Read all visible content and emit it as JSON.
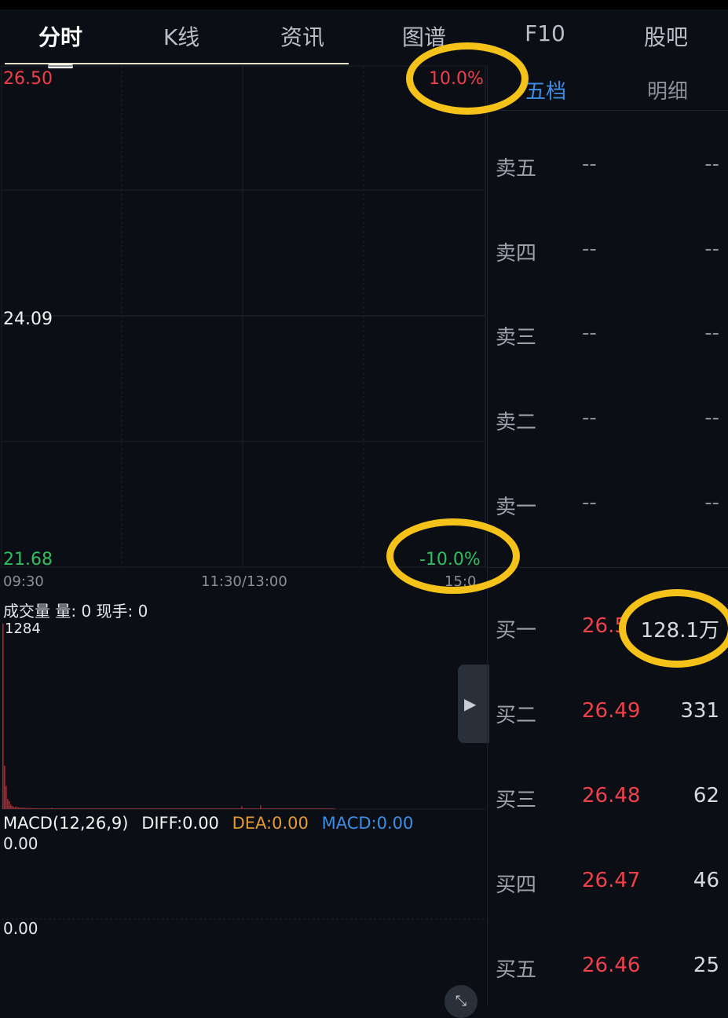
{
  "tabs": [
    {
      "label": "分时",
      "active": true
    },
    {
      "label": "K线"
    },
    {
      "label": "资讯"
    },
    {
      "label": "图谱"
    },
    {
      "label": "F10"
    },
    {
      "label": "股吧"
    }
  ],
  "chart": {
    "price_high": "26.50",
    "price_mid": "24.09",
    "price_low": "21.68",
    "pct_high": "10.0%",
    "pct_low": "-10.0%",
    "time_start": "09:30",
    "time_mid": "11:30/13:00",
    "time_end_partial": "15:0",
    "volume_title": "成交量  量: 0  现手: 0",
    "volume_max": "1284",
    "macd_label": "MACD(12,26,9)",
    "diff_label": "DIFF:0.00",
    "dea_label": "DEA:0.00",
    "macd_value_label": "MACD:0.00",
    "macd_top": "0.00",
    "macd_mid": "0.00",
    "volumes": [
      1284,
      300,
      160,
      70,
      55,
      30,
      22,
      14,
      14,
      14,
      10,
      10,
      10,
      9,
      9,
      8,
      8,
      7,
      7,
      7,
      6,
      6,
      6,
      6,
      6,
      5,
      5,
      5,
      5,
      5,
      5,
      10,
      5,
      5,
      5,
      5,
      5,
      5,
      5,
      5,
      5,
      5,
      5,
      5,
      5,
      5,
      5,
      5,
      5,
      5,
      5,
      5,
      5,
      5,
      5,
      5,
      5,
      5,
      5,
      5,
      5,
      5,
      5,
      5,
      5,
      5,
      5,
      5,
      5,
      5,
      5,
      5,
      5,
      5,
      5,
      5,
      5,
      5,
      5,
      5,
      5,
      5,
      5,
      5,
      5,
      5,
      5,
      5,
      5,
      5,
      5,
      5,
      5,
      5,
      5,
      5,
      5,
      5,
      5,
      5,
      5,
      5,
      5,
      5,
      5,
      5,
      5,
      5,
      5,
      5,
      5,
      5,
      5,
      5,
      5,
      5,
      5,
      5,
      5,
      5,
      5,
      5,
      5,
      5,
      5,
      5,
      5,
      5,
      5,
      5,
      5,
      5,
      5,
      5,
      5,
      5,
      5,
      5,
      5,
      5,
      5,
      5,
      5,
      5,
      5,
      5,
      5,
      5,
      5,
      5,
      5,
      5,
      20,
      5,
      5,
      5,
      5,
      5,
      5,
      5,
      5,
      5,
      5,
      5,
      25,
      5,
      5,
      5,
      5,
      5,
      5,
      5,
      5,
      5,
      5,
      5,
      5,
      5,
      5,
      5,
      5,
      5,
      5,
      5,
      5,
      5,
      5,
      5,
      5,
      5,
      5,
      5,
      5,
      5,
      5,
      5,
      5,
      5,
      5,
      5,
      5,
      5,
      5,
      5,
      5,
      5,
      5,
      5,
      5,
      5,
      5,
      5
    ]
  },
  "order_book": {
    "tab_active": "五档",
    "tab_inactive": "明细",
    "sell": [
      {
        "label": "卖五",
        "price": "--",
        "vol": "--"
      },
      {
        "label": "卖四",
        "price": "--",
        "vol": "--"
      },
      {
        "label": "卖三",
        "price": "--",
        "vol": "--"
      },
      {
        "label": "卖二",
        "price": "--",
        "vol": "--"
      },
      {
        "label": "卖一",
        "price": "--",
        "vol": "--"
      }
    ],
    "buy": [
      {
        "label": "买一",
        "price": "26.5",
        "vol": "128.1万"
      },
      {
        "label": "买二",
        "price": "26.49",
        "vol": "331"
      },
      {
        "label": "买三",
        "price": "26.48",
        "vol": "62"
      },
      {
        "label": "买四",
        "price": "26.47",
        "vol": "46"
      },
      {
        "label": "买五",
        "price": "26.46",
        "vol": "25"
      }
    ]
  },
  "icons": {
    "side_handle": "expand-right-icon",
    "corner": "fullscreen-icon"
  },
  "colors": {
    "up": "#f0404a",
    "down": "#2fbf5f",
    "annotation": "#f5c21a",
    "active_tab": "#3b8fe6"
  }
}
